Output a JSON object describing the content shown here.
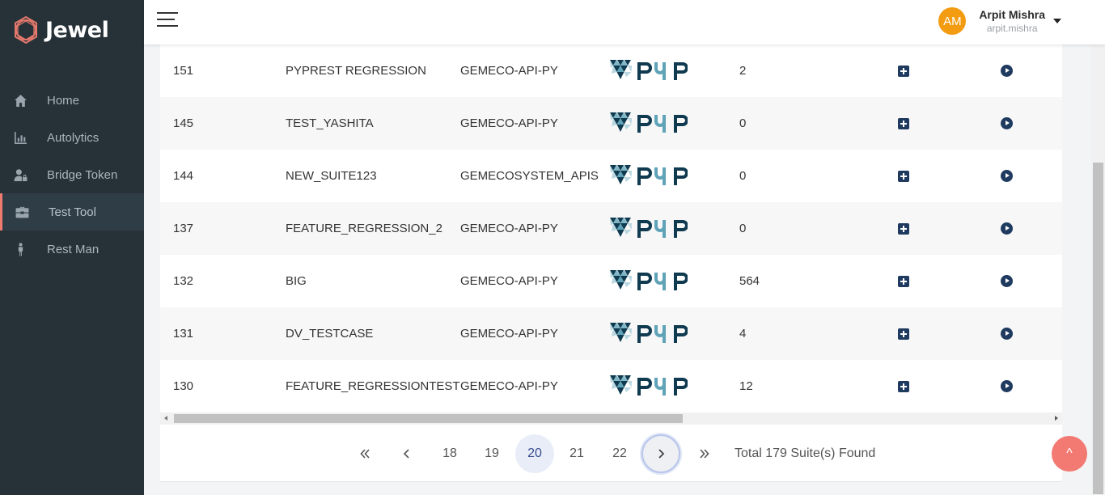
{
  "brand": {
    "name": "Jewel"
  },
  "sidebar": {
    "items": [
      {
        "label": "Home",
        "icon": "home-icon"
      },
      {
        "label": "Autolytics",
        "icon": "bar-chart-icon"
      },
      {
        "label": "Bridge Token",
        "icon": "user-lock-icon"
      },
      {
        "label": "Test Tool",
        "icon": "toolbox-icon",
        "active": true
      },
      {
        "label": "Rest Man",
        "icon": "person-icon"
      }
    ]
  },
  "header": {
    "user": {
      "initials": "AM",
      "name": "Arpit Mishra",
      "handle": "arpit.mishra"
    }
  },
  "table": {
    "rows": [
      {
        "id": "151",
        "name": "PYPREST REGRESSION",
        "project": "GEMECO-API-PY",
        "framework": "PYP",
        "count": "2"
      },
      {
        "id": "145",
        "name": "TEST_YASHITA",
        "project": "GEMECO-API-PY",
        "framework": "PYP",
        "count": "0"
      },
      {
        "id": "144",
        "name": "NEW_SUITE123",
        "project": "GEMECOSYSTEM_APIS",
        "framework": "PYP",
        "count": "0"
      },
      {
        "id": "137",
        "name": "FEATURE_REGRESSION_2",
        "project": "GEMECO-API-PY",
        "framework": "PYP",
        "count": "0"
      },
      {
        "id": "132",
        "name": "BIG",
        "project": "GEMECO-API-PY",
        "framework": "PYP",
        "count": "564"
      },
      {
        "id": "131",
        "name": "DV_TESTCASE",
        "project": "GEMECO-API-PY",
        "framework": "PYP",
        "count": "4"
      },
      {
        "id": "130",
        "name": "FEATURE_REGRESSIONTEST",
        "project": "GEMECO-API-PY",
        "framework": "PYP",
        "count": "12"
      }
    ]
  },
  "pagination": {
    "pages": [
      "18",
      "19",
      "20",
      "21",
      "22"
    ],
    "current": "20",
    "total_text": "Total 179 Suite(s) Found"
  },
  "scroll_top": {
    "label": "^"
  },
  "colors": {
    "sidebar": "#263238",
    "accent": "#ef7b6e",
    "avatar": "#f39c12",
    "icon": "#1e3a5f",
    "logo_dark": "#0f3a4f",
    "logo_light": "#5fa3b8"
  }
}
